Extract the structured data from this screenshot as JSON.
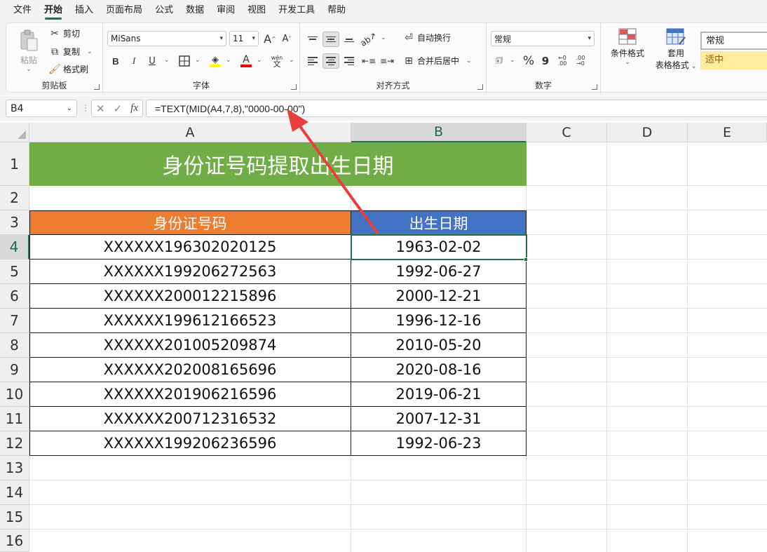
{
  "menu": [
    "文件",
    "开始",
    "插入",
    "页面布局",
    "公式",
    "数据",
    "审阅",
    "视图",
    "开发工具",
    "帮助"
  ],
  "menu_active": "开始",
  "ribbon": {
    "clipboard": {
      "paste": "粘贴",
      "cut": "剪切",
      "copy": "复制",
      "format_painter": "格式刷",
      "label": "剪贴板"
    },
    "font": {
      "name": "MiSans",
      "size": "11",
      "grow": "A",
      "shrink": "A",
      "bold": "B",
      "italic": "I",
      "underline": "U",
      "font_color": "A",
      "phonetic": "wén",
      "label": "字体"
    },
    "alignment": {
      "wrap": "自动换行",
      "merge": "合并后居中",
      "label": "对齐方式"
    },
    "number": {
      "format": "常规",
      "percent": "%",
      "comma": "9",
      "inc": "←0 .00",
      "dec": ".00 →0",
      "label": "数字"
    },
    "styles": {
      "conditional": "条件格式",
      "table_line1": "套用",
      "table_line2": "表格格式",
      "normal": "常规",
      "neutral": "适中",
      "label": "样"
    }
  },
  "formula_bar": {
    "name_box": "B4",
    "cancel": "✕",
    "enter": "✓",
    "fx": "fx",
    "formula": "=TEXT(MID(A4,7,8),\"0000-00-00\")"
  },
  "columns": [
    "A",
    "B",
    "C",
    "D",
    "E"
  ],
  "rows": [
    "1",
    "2",
    "3",
    "4",
    "5",
    "6",
    "7",
    "8",
    "9",
    "10",
    "11",
    "12",
    "13",
    "14",
    "15",
    "16"
  ],
  "sheet": {
    "title": "身份证号码提取出生日期",
    "header_a": "身份证号码",
    "header_b": "出生日期",
    "records": [
      {
        "id": "XXXXXX196302020125",
        "date": "1963-02-02"
      },
      {
        "id": "XXXXXX199206272563",
        "date": "1992-06-27"
      },
      {
        "id": "XXXXXX200012215896",
        "date": "2000-12-21"
      },
      {
        "id": "XXXXXX199612166523",
        "date": "1996-12-16"
      },
      {
        "id": "XXXXXX201005209874",
        "date": "2010-05-20"
      },
      {
        "id": "XXXXXX202008165696",
        "date": "2020-08-16"
      },
      {
        "id": "XXXXXX201906216596",
        "date": "2019-06-21"
      },
      {
        "id": "XXXXXX200712316532",
        "date": "2007-12-31"
      },
      {
        "id": "XXXXXX199206236596",
        "date": "1992-06-23"
      }
    ]
  },
  "colors": {
    "title_fill": "#70ad47",
    "header_a_fill": "#ed7d31",
    "header_b_fill": "#4472c4",
    "arrow": "#e8403c",
    "accent": "#217346"
  }
}
